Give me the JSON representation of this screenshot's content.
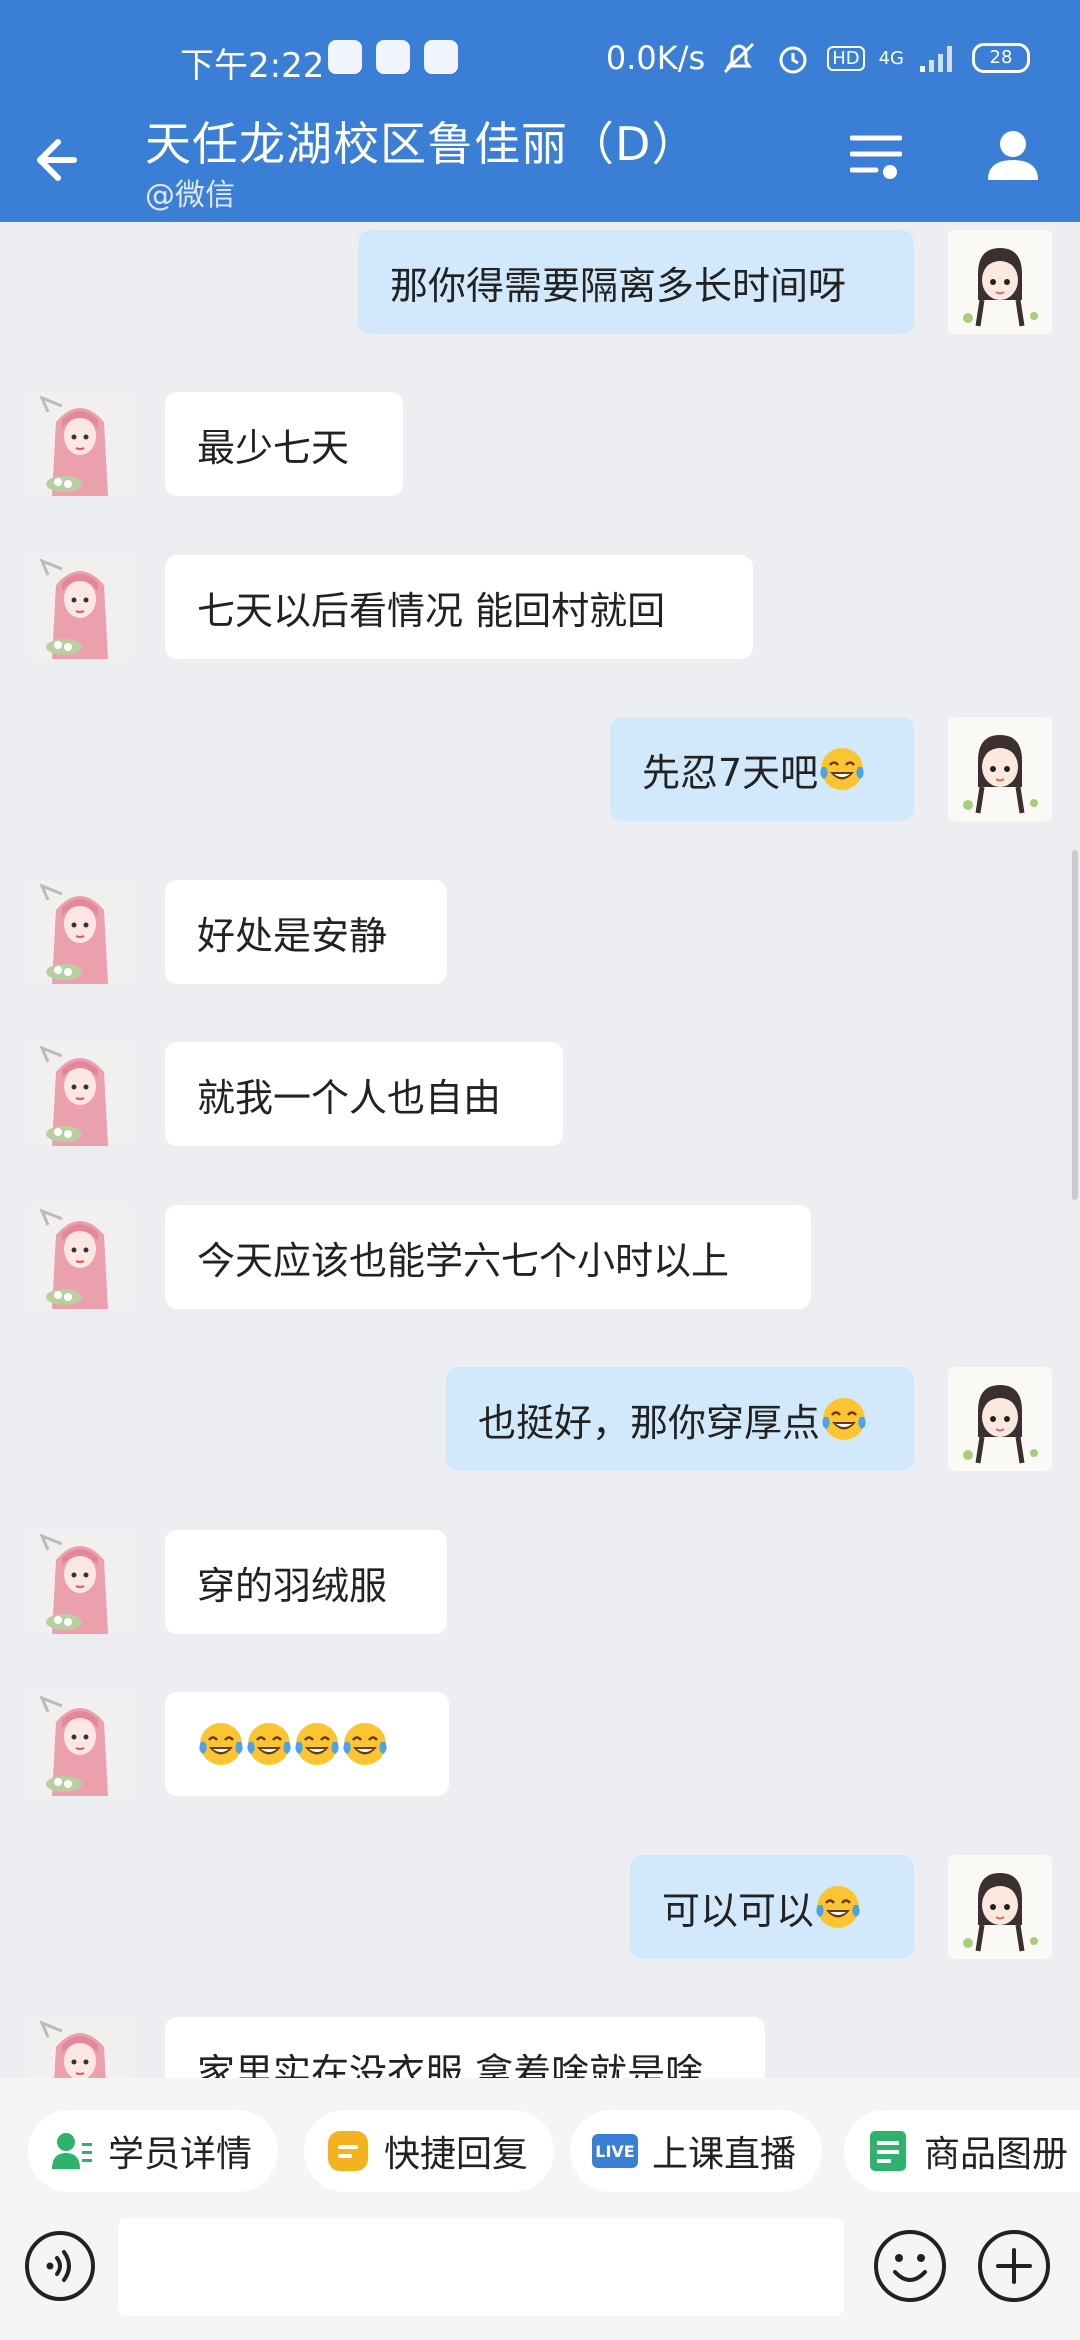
{
  "status_bar": {
    "time": "下午2:22",
    "net_speed": "0.0K/s",
    "hd": "HD",
    "network": "4G",
    "battery": "28"
  },
  "header": {
    "title": "天任龙湖校区鲁佳丽（D）",
    "subtitle": "@微信"
  },
  "messages": [
    {
      "side": "right",
      "text": "那你得需要隔离多长时间呀",
      "emoji": 0
    },
    {
      "side": "left",
      "text": "最少七天",
      "emoji": 0
    },
    {
      "side": "left",
      "text": "七天以后看情况  能回村就回",
      "emoji": 0
    },
    {
      "side": "right",
      "text": "先忍7天吧",
      "emoji": 1
    },
    {
      "side": "left",
      "text": "好处是安静",
      "emoji": 0
    },
    {
      "side": "left",
      "text": "就我一个人也自由",
      "emoji": 0
    },
    {
      "side": "left",
      "text": "今天应该也能学六七个小时以上",
      "emoji": 0
    },
    {
      "side": "right",
      "text": "也挺好，那你穿厚点",
      "emoji": 1
    },
    {
      "side": "left",
      "text": "穿的羽绒服",
      "emoji": 0
    },
    {
      "side": "left",
      "text": "",
      "emoji": 4
    },
    {
      "side": "right",
      "text": "可以可以",
      "emoji": 1
    },
    {
      "side": "left",
      "text": "家里实在没衣服  拿着啥就是啥",
      "emoji": 0
    }
  ],
  "toolbar": {
    "student_details": "学员详情",
    "quick_reply": "快捷回复",
    "live_class": "上课直播",
    "live_badge": "LIVE",
    "product_album": "商品图册"
  },
  "input": {
    "placeholder": ""
  },
  "icons": {
    "back": "back-arrow-icon",
    "filter": "filter-list-icon",
    "profile": "person-icon",
    "voice": "voice-icon",
    "emoji": "emoji-icon",
    "plus": "plus-icon"
  },
  "colors": {
    "header": "#3a7fd5",
    "chat_bg": "#edeef2",
    "bubble_self": "#d2e8fb",
    "bubble_other": "#ffffff"
  }
}
